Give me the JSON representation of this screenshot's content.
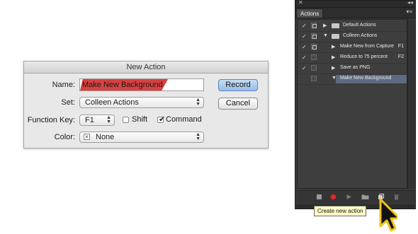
{
  "dialog": {
    "title": "New Action",
    "name_label": "Name:",
    "name_value": "Make New Background",
    "set_label": "Set:",
    "set_value": "Colleen Actions",
    "function_key_label": "Function Key:",
    "function_key_value": "F1",
    "shift_label": "Shift",
    "shift_checked": false,
    "command_label": "Command",
    "command_checked": true,
    "color_label": "Color:",
    "color_value": "None",
    "record_label": "Record",
    "cancel_label": "Cancel"
  },
  "panel": {
    "tab_label": "Actions",
    "rows": [
      {
        "checked": true,
        "dialog": true,
        "expanded": false,
        "folder": true,
        "indent": 0,
        "label": "Default Actions",
        "fkey": "",
        "selected": false
      },
      {
        "checked": true,
        "dialog": true,
        "expanded": true,
        "folder": true,
        "indent": 0,
        "label": "Colleen Actions",
        "fkey": "",
        "selected": false
      },
      {
        "checked": true,
        "dialog": true,
        "expanded": false,
        "folder": false,
        "indent": 1,
        "label": "Make New from Capture",
        "fkey": "F1",
        "selected": false
      },
      {
        "checked": true,
        "dialog": false,
        "expanded": false,
        "folder": false,
        "indent": 1,
        "label": "Reduce to 75 percent",
        "fkey": "F2",
        "selected": false
      },
      {
        "checked": true,
        "dialog": false,
        "expanded": false,
        "folder": false,
        "indent": 1,
        "label": "Save as PNG",
        "fkey": "",
        "selected": false
      },
      {
        "checked": false,
        "dialog": false,
        "expanded": true,
        "folder": false,
        "indent": 1,
        "label": "Make New Background",
        "fkey": "",
        "selected": true
      }
    ],
    "tooltip": "Create new action",
    "colors": {
      "record": "#e0262a",
      "accent_selected": "#5e6a80"
    }
  }
}
